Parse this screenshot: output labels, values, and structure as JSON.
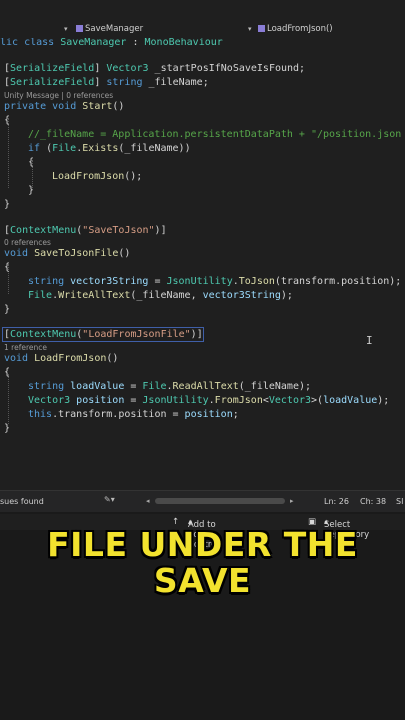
{
  "nav": {
    "class_dropdown": "SaveManager",
    "method_dropdown": "LoadFromJson()"
  },
  "code": {
    "l1": {
      "a": "lic class ",
      "b": "SaveManager",
      "c": " : ",
      "d": "MonoBehaviour"
    },
    "l3": {
      "a": "[",
      "b": "SerializeField",
      "c": "] ",
      "d": "Vector3",
      "e": " _startPosIfNoSaveIsFound;"
    },
    "l4": {
      "a": "[",
      "b": "SerializeField",
      "c": "] ",
      "d": "string",
      "e": " _fileName;"
    },
    "h1": "Unity Message | 0 references",
    "l5": {
      "a": "private void ",
      "b": "Start",
      "c": "()"
    },
    "l6": "{",
    "l8": {
      "a": "//_fileName = Application.persistentDataPath + \"/position.json"
    },
    "l9": {
      "a": "if",
      "b": " (",
      "c": "File",
      "d": ".",
      "e": "Exists",
      "f": "(_fileName))"
    },
    "l10": "{",
    "l11": {
      "a": "LoadFromJson",
      "b": "();"
    },
    "l12": "}",
    "l13": "}",
    "l15": {
      "a": "[",
      "b": "ContextMenu",
      "c": "(",
      "d": "\"SaveToJson\"",
      "e": ")]"
    },
    "h2": "0 references",
    "l16": {
      "a": "void ",
      "b": "SaveToJsonFile",
      "c": "()"
    },
    "l17": "{",
    "l18": {
      "a": "string ",
      "b": "vector3String",
      "c": " = ",
      "d": "JsonUtility",
      "e": ".",
      "f": "ToJson",
      "g": "(transform.position);"
    },
    "l19": {
      "a": "File",
      "b": ".",
      "c": "WriteAllText",
      "d": "(_fileName, ",
      "e": "vector3String",
      "f": ");"
    },
    "l20": "}",
    "l22": {
      "a": "[",
      "b": "ContextMenu",
      "c": "(",
      "d": "\"LoadFromJsonFile\"",
      "e": ")]"
    },
    "h3": "1 reference",
    "l23": {
      "a": "void ",
      "b": "LoadFromJson",
      "c": "()"
    },
    "l24": "{",
    "l25": {
      "a": "string ",
      "b": "loadValue",
      "c": " = ",
      "d": "File",
      "e": ".",
      "f": "ReadAllText",
      "g": "(_fileName);"
    },
    "l26": {
      "a": "Vector3 ",
      "b": "position",
      "c": " = ",
      "d": "JsonUtility",
      "e": ".",
      "f": "FromJson",
      "g": "<",
      "h": "Vector3",
      "i": ">(",
      "j": "loadValue",
      "k": ");"
    },
    "l27": {
      "a": "this",
      "b": ".transform.position = ",
      "c": "position",
      "d": ";"
    },
    "l28": "}"
  },
  "status": {
    "issues": "sues found",
    "line": "Ln: 26",
    "col": "Ch: 38",
    "tail": "SI"
  },
  "source_bar": {
    "add_to_source_control": "Add to Source Control",
    "select_repository": "Select Repository"
  },
  "caption": {
    "line1": "FILE UNDER THE",
    "line2": "SAVE"
  }
}
